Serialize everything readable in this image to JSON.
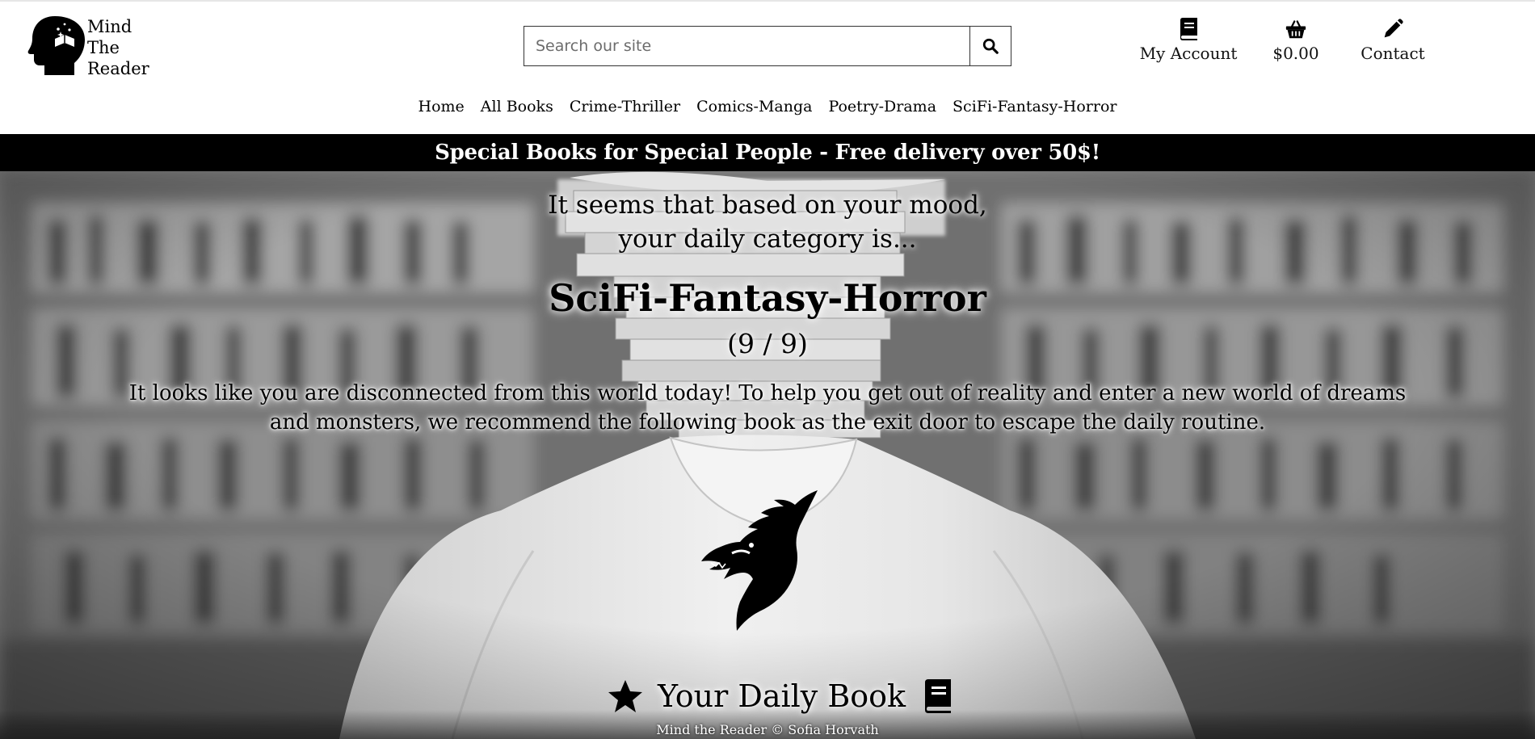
{
  "brand": {
    "name_lines": [
      "Mind",
      "The",
      "Reader"
    ],
    "logo_icon": "head-book-icon"
  },
  "search": {
    "placeholder": "Search our site",
    "value": "",
    "button_icon": "search-icon"
  },
  "top_nav": {
    "account": {
      "label": "My Account",
      "icon": "book-icon"
    },
    "basket": {
      "label": "$0.00",
      "icon": "basket-icon"
    },
    "contact": {
      "label": "Contact",
      "icon": "pencil-icon"
    }
  },
  "categories": [
    "Home",
    "All Books",
    "Crime-Thriller",
    "Comics-Manga",
    "Poetry-Drama",
    "SciFi-Fantasy-Horror"
  ],
  "banner": {
    "text": "Special Books for Special People - Free delivery over 50$!"
  },
  "hero": {
    "mood_line1": "It seems that based on your mood,",
    "mood_line2": "your daily category is...",
    "category": "SciFi-Fantasy-Horror",
    "counter": "(9 / 9)",
    "description": "It looks like you are disconnected from this world today! To help you get out of reality and enter a new world of dreams and monsters, we recommend the following book as the exit door to escape the daily routine.",
    "category_icon": "dragon-icon",
    "daily_title": "Your Daily Book",
    "daily_left_icon": "star-icon",
    "daily_right_icon": "book-icon"
  },
  "footer": {
    "text": "Mind the Reader © Sofia Horvath"
  },
  "colors": {
    "banner_bg": "#000000",
    "banner_text": "#ffffff",
    "page_bg": "#ffffff"
  }
}
